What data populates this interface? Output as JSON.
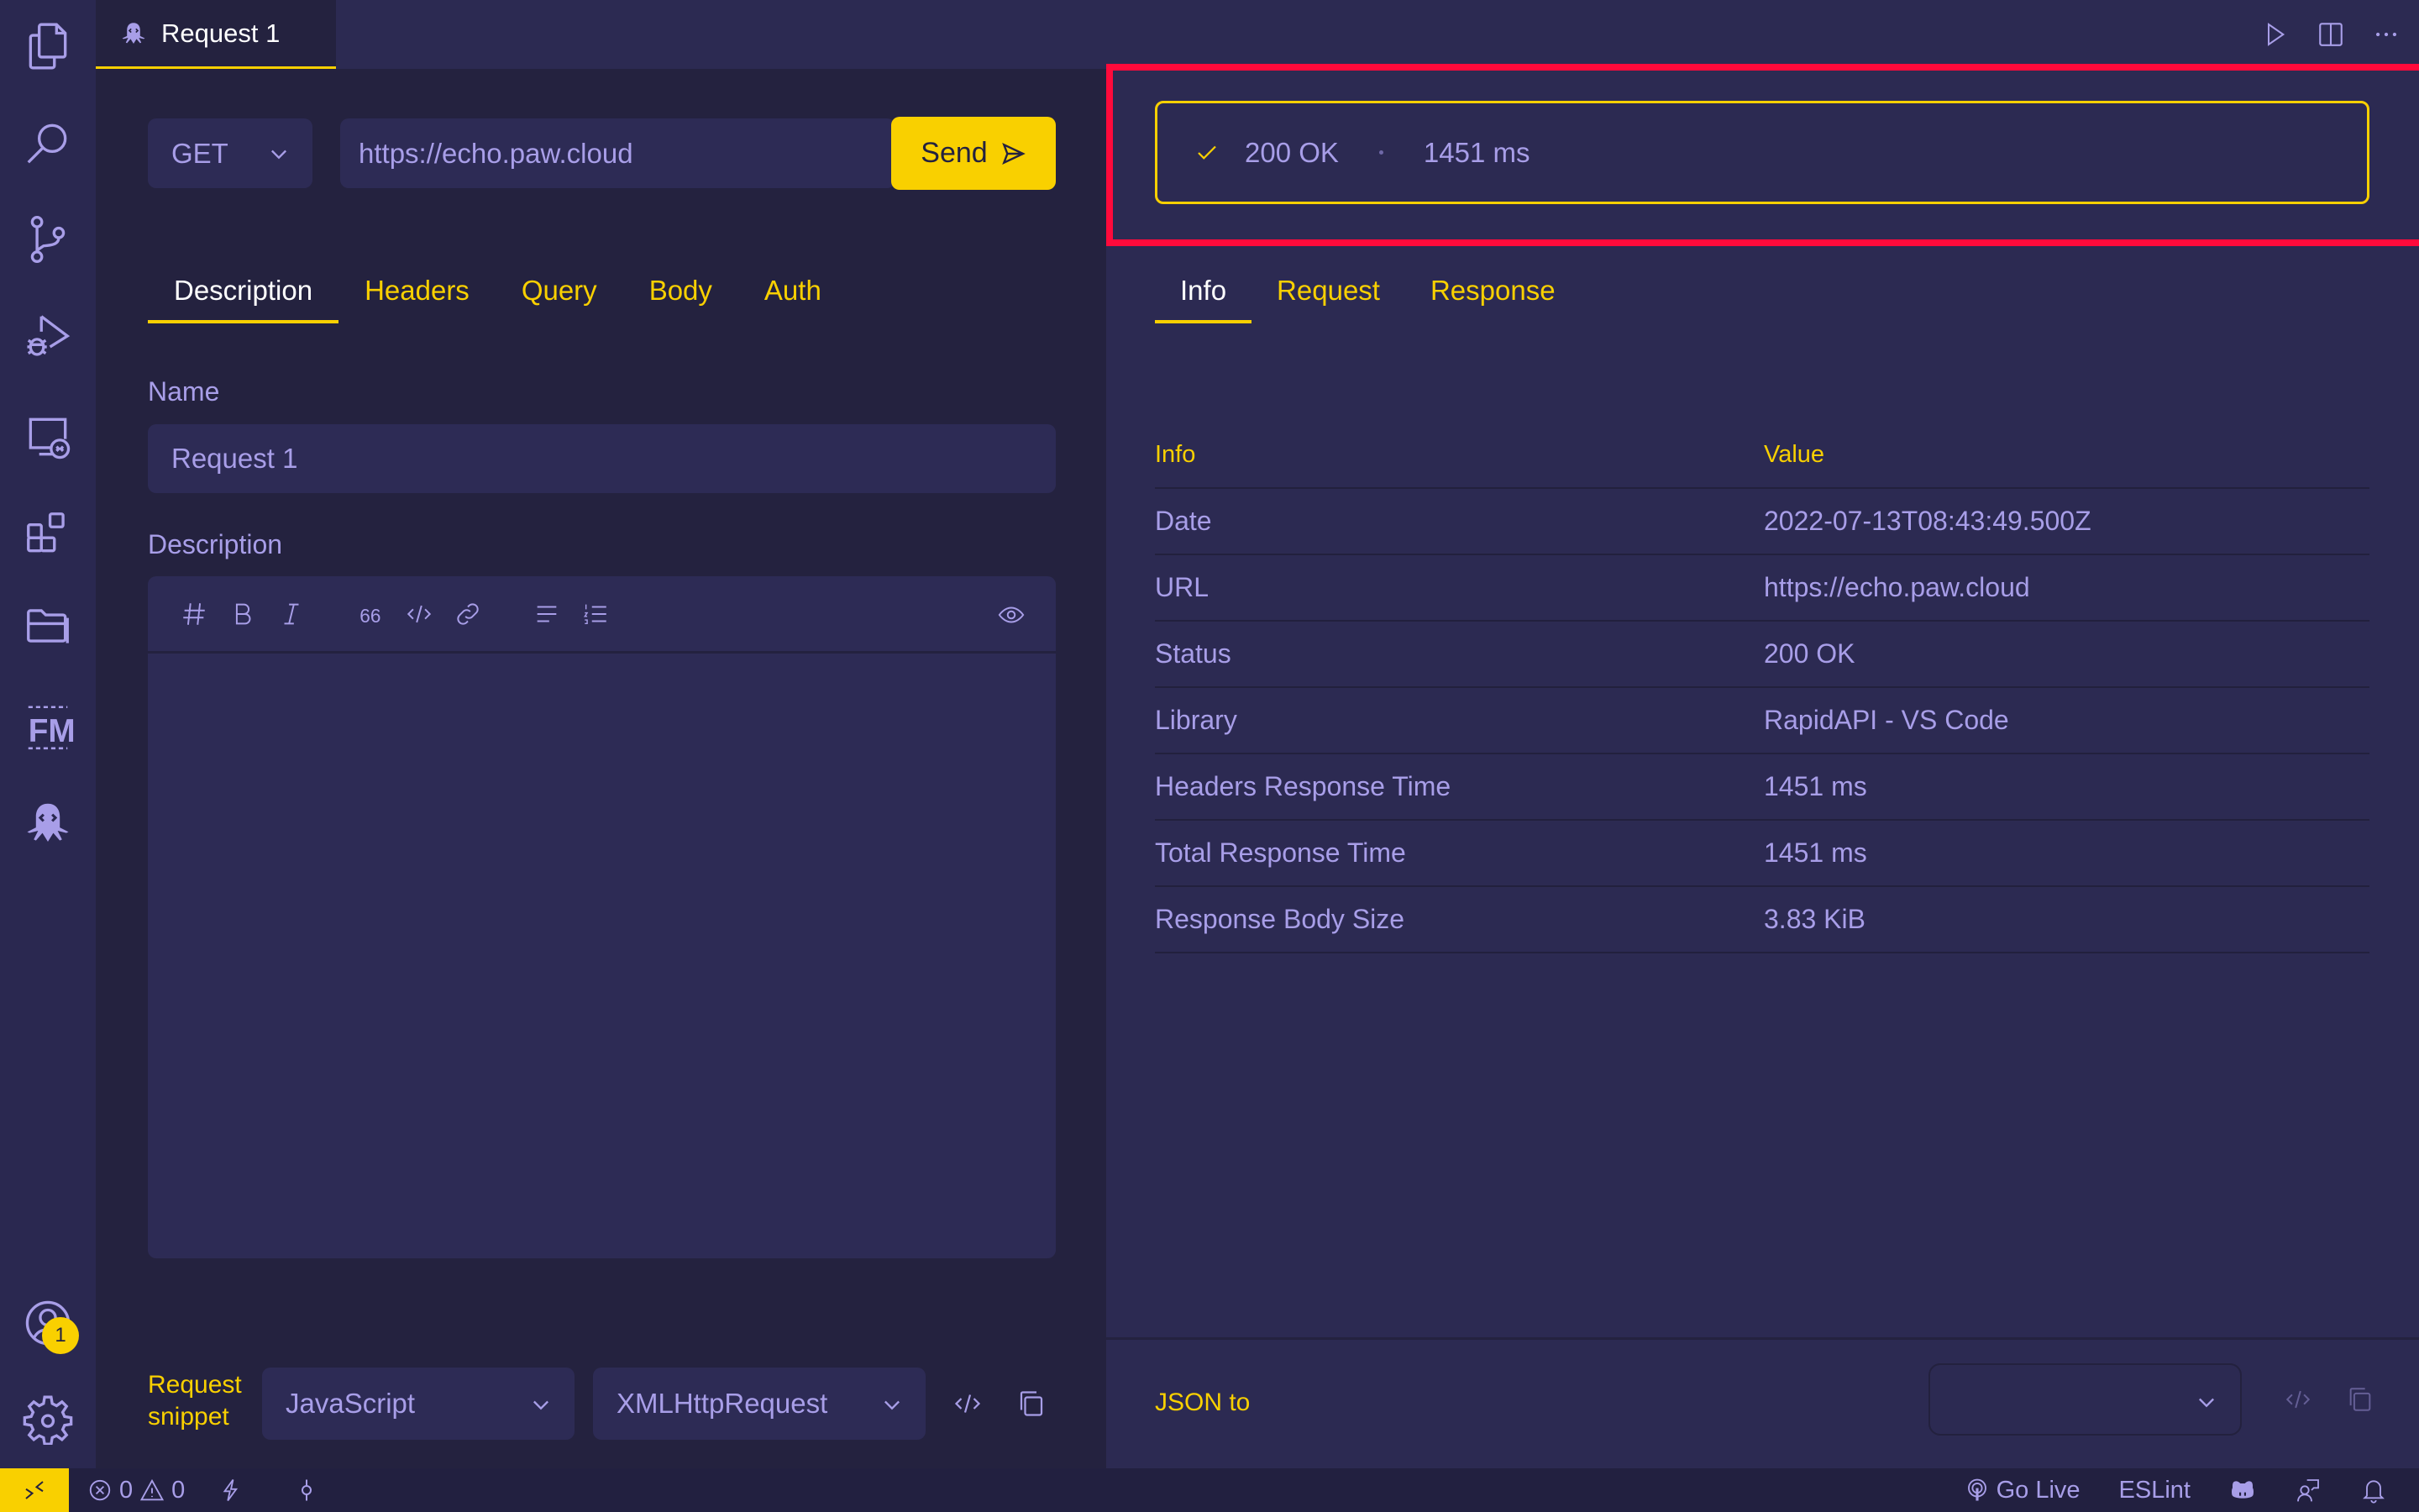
{
  "colors": {
    "accent": "#f9d000",
    "text": "#a89ee8",
    "background": "#24223f",
    "panel": "#2c2a52",
    "highlight": "#ff0a3b"
  },
  "activity_bar": {
    "items": [
      {
        "icon": "explorer-icon"
      },
      {
        "icon": "search-icon"
      },
      {
        "icon": "source-control-icon"
      },
      {
        "icon": "run-debug-icon"
      },
      {
        "icon": "remote-explorer-icon"
      },
      {
        "icon": "extensions-icon"
      },
      {
        "icon": "project-manager-icon"
      },
      {
        "icon": "fm-icon"
      },
      {
        "icon": "rapidapi-icon"
      }
    ],
    "accounts_badge": "1"
  },
  "editor_tab": {
    "label": "Request 1"
  },
  "request": {
    "method": "GET",
    "url": "https://echo.paw.cloud",
    "send_label": "Send",
    "tabs": [
      "Description",
      "Headers",
      "Query",
      "Body",
      "Auth"
    ],
    "active_tab": "Description",
    "name_label": "Name",
    "name_value": "Request 1",
    "description_label": "Description",
    "snippet_label_line1": "Request",
    "snippet_label_line2": "snippet",
    "snippet_language": "JavaScript",
    "snippet_library": "XMLHttpRequest"
  },
  "response": {
    "status": "200 OK",
    "time": "1451 ms",
    "tabs": [
      "Info",
      "Request",
      "Response"
    ],
    "active_tab": "Info",
    "table": {
      "headers": [
        "Info",
        "Value"
      ],
      "rows": [
        [
          "Date",
          "2022-07-13T08:43:49.500Z"
        ],
        [
          "URL",
          "https://echo.paw.cloud"
        ],
        [
          "Status",
          "200 OK"
        ],
        [
          "Library",
          "RapidAPI - VS Code"
        ],
        [
          "Headers Response Time",
          "1451 ms"
        ],
        [
          "Total Response Time",
          "1451 ms"
        ],
        [
          "Response Body Size",
          "3.83 KiB"
        ]
      ]
    },
    "json_to_label": "JSON to",
    "json_to_value": ""
  },
  "status_bar": {
    "errors": "0",
    "warnings": "0",
    "go_live": "Go Live",
    "eslint": "ESLint"
  }
}
